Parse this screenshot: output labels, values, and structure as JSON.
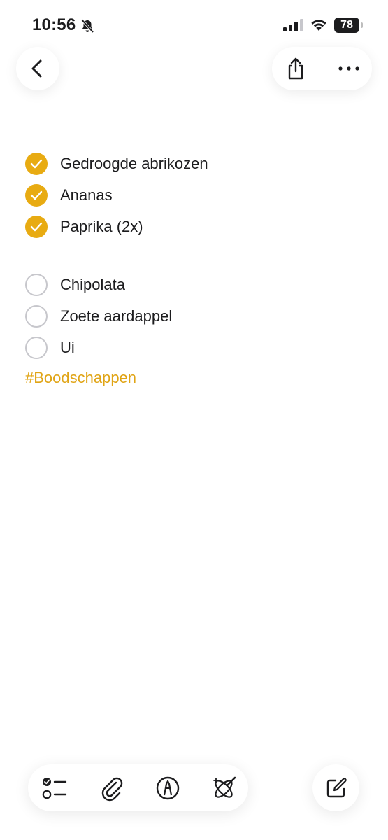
{
  "status_bar": {
    "time": "10:56",
    "battery_level": "78",
    "icons": [
      "bell-slash-icon",
      "cellular-signal-icon",
      "wifi-icon",
      "battery-icon"
    ]
  },
  "header": {
    "back_icon": "chevron-left-icon",
    "share_icon": "share-icon",
    "more_icon": "ellipsis-icon"
  },
  "note": {
    "checked_items": [
      {
        "label": "Gedroogde abrikozen",
        "checked": true
      },
      {
        "label": "Ananas",
        "checked": true
      },
      {
        "label": "Paprika (2x)",
        "checked": true
      }
    ],
    "unchecked_items": [
      {
        "label": "Chipolata",
        "checked": false
      },
      {
        "label": "Zoete aardappel",
        "checked": false
      },
      {
        "label": "Ui",
        "checked": false
      }
    ],
    "tag": "#Boodschappen"
  },
  "toolbar": {
    "icons": [
      "checklist-icon",
      "paperclip-icon",
      "markup-pen-icon",
      "writing-tools-icon"
    ],
    "compose_icon": "compose-icon"
  },
  "colors": {
    "accent": "#e8ab12",
    "tag": "#e0a415",
    "unchecked_border": "#c7c7cc",
    "text": "#1c1c1e"
  }
}
